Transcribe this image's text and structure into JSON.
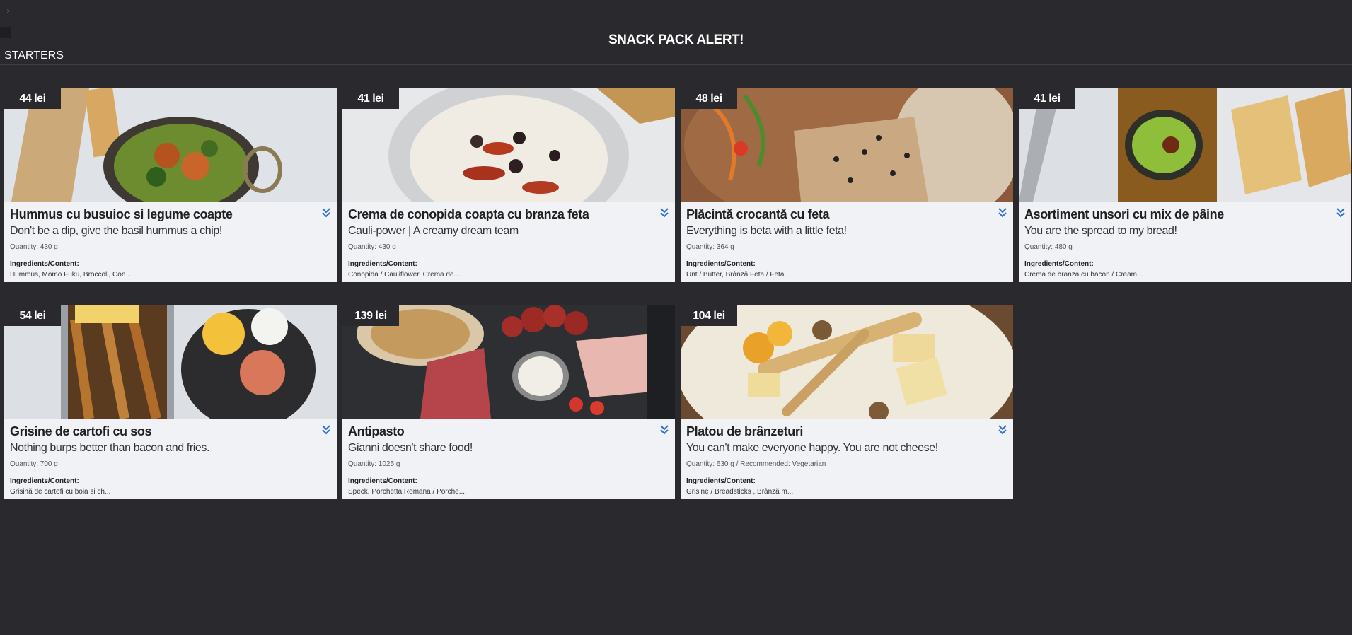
{
  "toggle": {
    "icon": "caret-right-icon",
    "glyph": "›"
  },
  "header": {
    "title": "SNACK PACK ALERT!"
  },
  "section": {
    "title": "STARTERS"
  },
  "colors": {
    "background": "#2a292e",
    "card": "#f1f2f6",
    "accent": "#2f6fd6"
  },
  "cards": [
    {
      "price": "44 lei",
      "name": "Hummus cu busuioc si legume coapte",
      "tagline": "Don't be a dip, give the basil hummus a chip!",
      "quantity": "Quantity: 430 g",
      "ingredients_label": "Ingredients/Content:",
      "ingredients": "Hummus, Momo Fuku, Broccoli, Con..."
    },
    {
      "price": "41 lei",
      "name": "Crema de conopida coapta cu branza feta",
      "tagline": "Cauli-power | A creamy dream team",
      "quantity": "Quantity: 430 g",
      "ingredients_label": "Ingredients/Content:",
      "ingredients": "Conopida / Cauliflower, Crema de..."
    },
    {
      "price": "48 lei",
      "name": "Plăcintă crocantă cu feta",
      "tagline": "Everything is beta with a little feta!",
      "quantity": "Quantity: 364 g",
      "ingredients_label": "Ingredients/Content:",
      "ingredients": "Unt / Butter, Brânză Feta / Feta..."
    },
    {
      "price": "41 lei",
      "name": "Asortiment unsori cu mix de pâine",
      "tagline": "You are the spread to my bread!",
      "quantity": "Quantity: 480 g",
      "ingredients_label": "Ingredients/Content:",
      "ingredients": "Crema de branza cu bacon / Cream..."
    },
    {
      "price": "54 lei",
      "name": "Grisine de cartofi cu sos",
      "tagline": "Nothing burps better than bacon and fries.",
      "quantity": "Quantity: 700 g",
      "ingredients_label": "Ingredients/Content:",
      "ingredients": "Grisină de cartofi cu boia si ch..."
    },
    {
      "price": "139 lei",
      "name": "Antipasto",
      "tagline": "Gianni doesn't share food!",
      "quantity": "Quantity: 1025 g",
      "ingredients_label": "Ingredients/Content:",
      "ingredients": "Speck, Porchetta Romana / Porche..."
    },
    {
      "price": "104 lei",
      "name": "Platou de brânzeturi",
      "tagline": "You can't make everyone happy. You are not cheese!",
      "quantity": "Quantity: 630 g / Recommended: Vegetarian",
      "ingredients_label": "Ingredients/Content:",
      "ingredients": "Grisine / Breadsticks , Brânză m..."
    }
  ]
}
